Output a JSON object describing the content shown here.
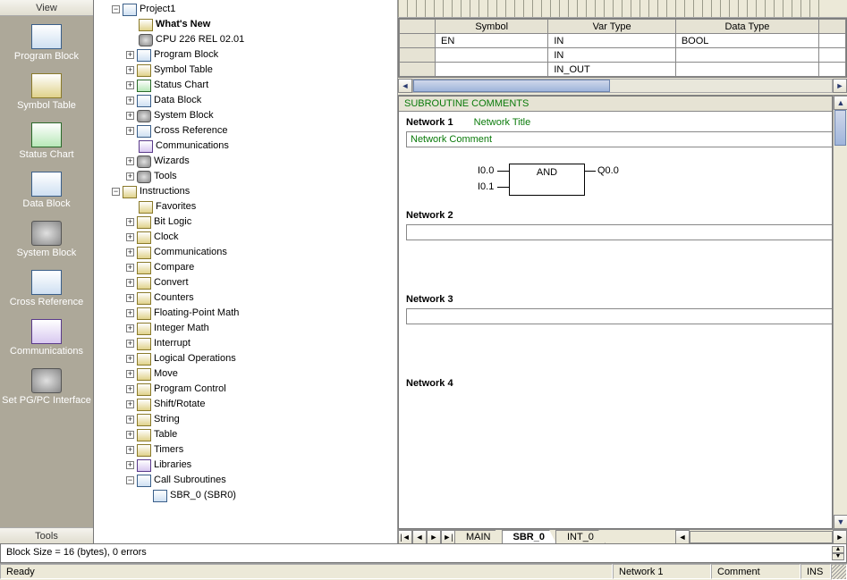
{
  "side": {
    "view_label": "View",
    "tools_label": "Tools",
    "items": [
      {
        "label": "Program Block"
      },
      {
        "label": "Symbol Table"
      },
      {
        "label": "Status Chart"
      },
      {
        "label": "Data Block"
      },
      {
        "label": "System Block"
      },
      {
        "label": "Cross Reference"
      },
      {
        "label": "Communications"
      },
      {
        "label": "Set PG/PC Interface"
      }
    ]
  },
  "tree": {
    "project": "Project1",
    "whats_new": "What's New",
    "cpu": "CPU 226 REL 02.01",
    "blocks": [
      "Program Block",
      "Symbol Table",
      "Status Chart",
      "Data Block",
      "System Block",
      "Cross Reference",
      "Communications",
      "Wizards",
      "Tools"
    ],
    "instructions_label": "Instructions",
    "favorites": "Favorites",
    "categories": [
      "Bit Logic",
      "Clock",
      "Communications",
      "Compare",
      "Convert",
      "Counters",
      "Floating-Point Math",
      "Integer Math",
      "Interrupt",
      "Logical Operations",
      "Move",
      "Program Control",
      "Shift/Rotate",
      "String",
      "Table",
      "Timers",
      "Libraries",
      "Call Subroutines"
    ],
    "sub_item": "SBR_0 (SBR0)"
  },
  "vartab": {
    "headers": [
      "",
      "Symbol",
      "Var Type",
      "Data Type",
      ""
    ],
    "rows": [
      {
        "symbol": "EN",
        "vartype": "IN",
        "datatype": "BOOL"
      },
      {
        "symbol": "",
        "vartype": "IN",
        "datatype": ""
      },
      {
        "symbol": "",
        "vartype": "IN_OUT",
        "datatype": ""
      }
    ]
  },
  "code": {
    "sub_header": "SUBROUTINE COMMENTS",
    "networks": [
      {
        "title": "Network 1",
        "subtitle": "Network Title",
        "comment": "Network Comment",
        "fbd": {
          "func": "AND",
          "in0": "I0.0",
          "in1": "I0.1",
          "out": "Q0.0"
        }
      },
      {
        "title": "Network 2"
      },
      {
        "title": "Network 3"
      },
      {
        "title": "Network 4"
      }
    ]
  },
  "tabs": {
    "main": "MAIN",
    "sbr": "SBR_0",
    "int": "INT_0",
    "active": "SBR_0"
  },
  "outbar": "Block Size = 16 (bytes), 0 errors",
  "status": {
    "ready": "Ready",
    "net": "Network 1",
    "field": "Comment",
    "ins": "INS"
  }
}
